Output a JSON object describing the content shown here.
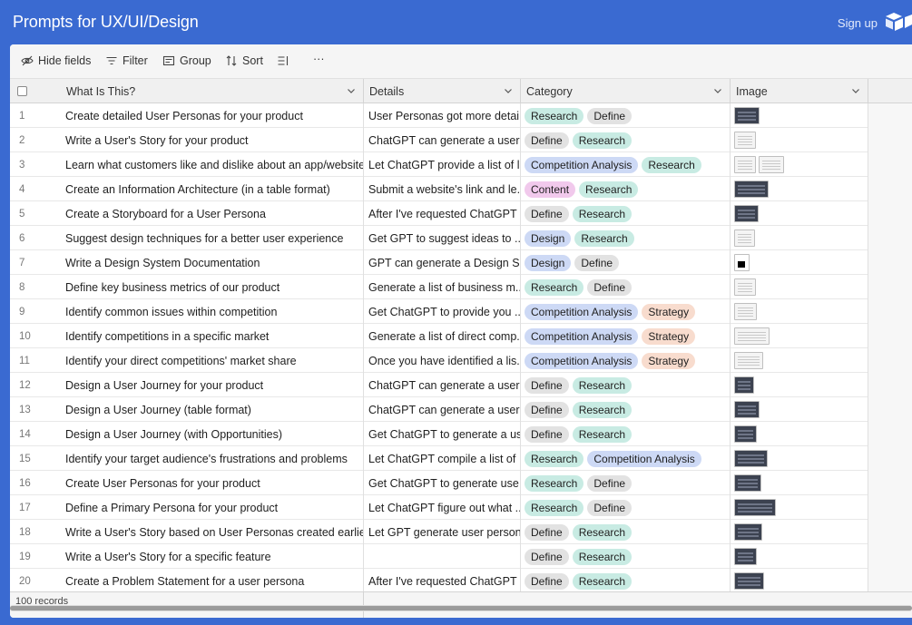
{
  "app": {
    "title": "Prompts for UX/UI/Design",
    "signup_label": "Sign up"
  },
  "colors": {
    "accent": "#3a6ad1",
    "tag_research": "#c8ebe3",
    "tag_define": "#e2e2e2",
    "tag_competition": "#cdd9f5",
    "tag_strategy": "#f8dcce",
    "tag_content": "#f1c9ec",
    "tag_design": "#cdd9f5"
  },
  "toolbar": {
    "hide_fields": "Hide fields",
    "filter": "Filter",
    "group": "Group",
    "sort": "Sort",
    "more": "···"
  },
  "columns": {
    "what": "What Is This?",
    "details": "Details",
    "category": "Category",
    "image": "Image"
  },
  "rows": [
    {
      "n": "1",
      "what": "Create detailed User Personas for your product",
      "details": "User Personas got more detai...",
      "tags": [
        "Research",
        "Define"
      ],
      "images": [
        "dark:28"
      ]
    },
    {
      "n": "2",
      "what": "Write a User's Story for your product",
      "details": "ChatGPT can generate a user...",
      "tags": [
        "Define",
        "Research"
      ],
      "images": [
        "light:24"
      ]
    },
    {
      "n": "3",
      "what": "Learn what customers like and dislike about an app/website",
      "details": "Let ChatGPT provide a list of l...",
      "tags": [
        "Competition Analysis",
        "Research"
      ],
      "images": [
        "light:24",
        "light:28"
      ]
    },
    {
      "n": "4",
      "what": "Create an Information Architecture (in a table format)",
      "details": "Submit a website's link and le...",
      "tags": [
        "Content",
        "Research"
      ],
      "images": [
        "dark:38"
      ]
    },
    {
      "n": "5",
      "what": "Create a Storyboard for a User Persona",
      "details": "After I've requested ChatGPT ...",
      "tags": [
        "Define",
        "Research"
      ],
      "images": [
        "dark:27"
      ]
    },
    {
      "n": "6",
      "what": "Suggest design techniques for a better user experience",
      "details": "Get GPT to suggest ideas to ...",
      "tags": [
        "Design",
        "Research"
      ],
      "images": [
        "light:23"
      ]
    },
    {
      "n": "7",
      "what": "Write a Design System Documentation",
      "details": "GPT can generate a Design S...",
      "tags": [
        "Design",
        "Define"
      ],
      "images": [
        "black:17"
      ]
    },
    {
      "n": "8",
      "what": "Define key business metrics of our product",
      "details": "Generate a list of business m...",
      "tags": [
        "Research",
        "Define"
      ],
      "images": [
        "light:24"
      ]
    },
    {
      "n": "9",
      "what": "Identify common issues within competition",
      "details": "Get ChatGPT to provide you ...",
      "tags": [
        "Competition Analysis",
        "Strategy"
      ],
      "images": [
        "light:25"
      ]
    },
    {
      "n": "10",
      "what": "Identify competitions in a specific market",
      "details": "Generate a list of direct comp...",
      "tags": [
        "Competition Analysis",
        "Strategy"
      ],
      "images": [
        "light:39"
      ]
    },
    {
      "n": "11",
      "what": "Identify your direct competitions' market share",
      "details": "Once you have identified a lis...",
      "tags": [
        "Competition Analysis",
        "Strategy"
      ],
      "images": [
        "light:32"
      ]
    },
    {
      "n": "12",
      "what": "Design a User Journey for your product",
      "details": "ChatGPT can generate a user...",
      "tags": [
        "Define",
        "Research"
      ],
      "images": [
        "dark:22"
      ]
    },
    {
      "n": "13",
      "what": "Design a User Journey (table format)",
      "details": "ChatGPT can generate a user...",
      "tags": [
        "Define",
        "Research"
      ],
      "images": [
        "dark:28"
      ]
    },
    {
      "n": "14",
      "what": "Design a User Journey (with Opportunities)",
      "details": "Get ChatGPT to generate a us...",
      "tags": [
        "Define",
        "Research"
      ],
      "images": [
        "dark:25"
      ]
    },
    {
      "n": "15",
      "what": "Identify your target audience's frustrations and problems",
      "details": "Let ChatGPT compile a list of ...",
      "tags": [
        "Research",
        "Competition Analysis"
      ],
      "images": [
        "dark:37"
      ]
    },
    {
      "n": "16",
      "what": "Create User Personas for your product",
      "details": "Get ChatGPT to generate use...",
      "tags": [
        "Research",
        "Define"
      ],
      "images": [
        "dark:30"
      ]
    },
    {
      "n": "17",
      "what": "Define a Primary Persona for your product",
      "details": "Let ChatGPT figure out what ...",
      "tags": [
        "Research",
        "Define"
      ],
      "images": [
        "dark:46"
      ]
    },
    {
      "n": "18",
      "what": "Write a User's Story based on User Personas created earlier",
      "details": "Let GPT generate user person...",
      "tags": [
        "Define",
        "Research"
      ],
      "images": [
        "dark:31"
      ]
    },
    {
      "n": "19",
      "what": "Write a User's Story for a specific feature",
      "details": "",
      "tags": [
        "Define",
        "Research"
      ],
      "images": [
        "dark:25"
      ]
    },
    {
      "n": "20",
      "what": "Create a Problem Statement for a user persona",
      "details": "After I've requested ChatGPT ...",
      "tags": [
        "Define",
        "Research"
      ],
      "images": [
        "dark:33"
      ]
    }
  ],
  "footer": {
    "records": "100 records"
  }
}
